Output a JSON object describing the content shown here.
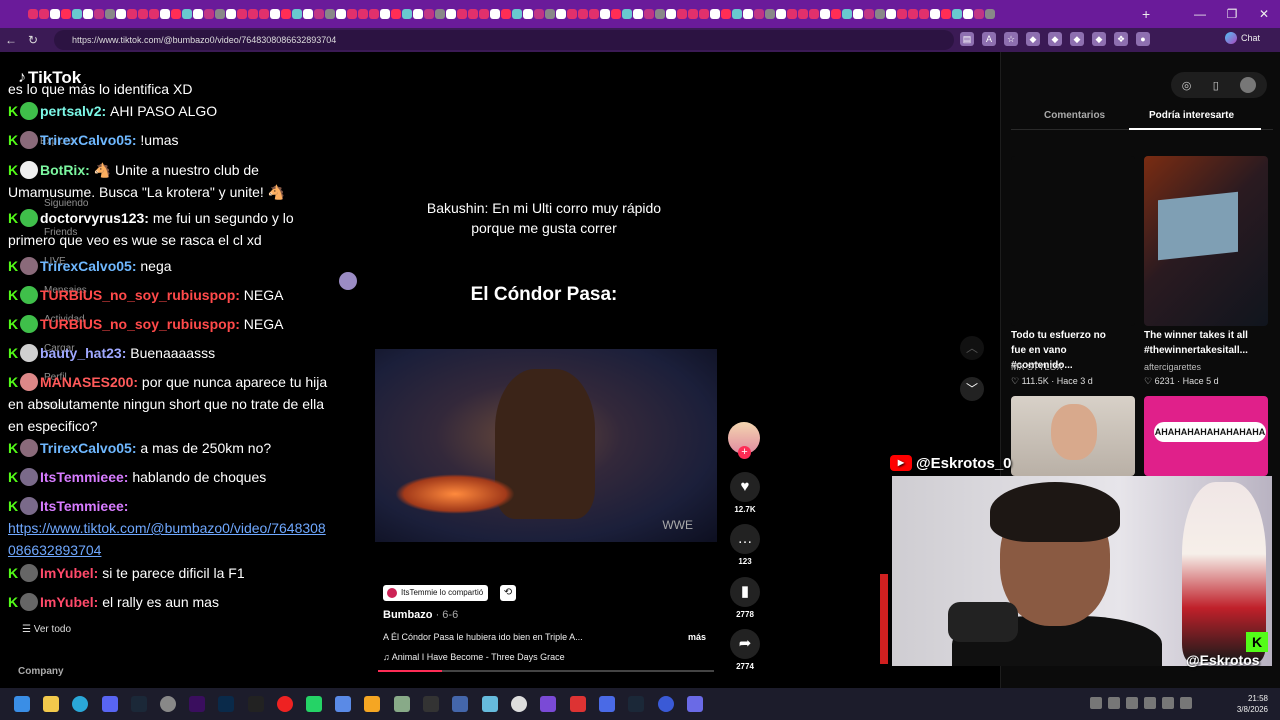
{
  "browser": {
    "url": "https://www.tiktok.com/@bumbazo0/video/7648308086632893704",
    "chat_label": "Chat",
    "new_tab": "+",
    "controls": [
      "—",
      "❐",
      "✕"
    ]
  },
  "tiktok": {
    "logo": "TikTok",
    "sidebar_ghost": [
      "Explorar",
      "Siguiendo",
      "Friends",
      "LIVE",
      "Mensajes",
      "Actividad",
      "Cargar",
      "Perfil",
      "Más"
    ],
    "ver_todo": "Ver todo",
    "company": "Company"
  },
  "chat": [
    {
      "user": "",
      "text": "es lo que más lo identifica XD",
      "color": "#ffffff"
    },
    {
      "user": "pertsalv2:",
      "text": "AHI PASO ALGO",
      "color": "#7cf7e6"
    },
    {
      "user": "TrirexCalvo05:",
      "text": "!umas",
      "color": "#6fb8ff"
    },
    {
      "user": "BotRix:",
      "text": "🐴 Unite a nuestro club de Umamusume. Busca \"La krotera\" y unite! 🐴",
      "color": "#7cf7a0"
    },
    {
      "user": "doctorvyrus123:",
      "text": "me fui un segundo y lo primero que veo es wue se rasca el cl xd",
      "color": "#ffffff"
    },
    {
      "user": "TrirexCalvo05:",
      "text": "nega",
      "color": "#6fb8ff"
    },
    {
      "user": "TURBIUS_no_soy_rubiuspop:",
      "text": "NEGA",
      "color": "#ff4a4a"
    },
    {
      "user": "TURBIUS_no_soy_rubiuspop:",
      "text": "NEGA",
      "color": "#ff4a4a"
    },
    {
      "user": "bauty_hat23:",
      "text": "Buenaaaasss",
      "color": "#9fa8ff"
    },
    {
      "user": "MANASES200:",
      "text": "por que nunca aparece tu hija en absolutamente ningun short que no trate de ella en especifico?",
      "color": "#ff5a5a"
    },
    {
      "user": "TrirexCalvo05:",
      "text": "a mas de 250km no?",
      "color": "#6fb8ff"
    },
    {
      "user": "ItsTemmieee:",
      "text": "hablando de choques",
      "color": "#d77cff"
    },
    {
      "user": "ItsTemmieee:",
      "text": "",
      "color": "#d77cff"
    },
    {
      "user": "",
      "text": "https://www.tiktok.com/@bumbazo0/video/7648308086632893704",
      "color": "#6fa8ff"
    },
    {
      "user": "ImYubel:",
      "text": "si te parece dificil la F1",
      "color": "#ff4a6a"
    },
    {
      "user": "ImYubel:",
      "text": "el rally es aun mas",
      "color": "#ff4a6a"
    }
  ],
  "video": {
    "caption": "Bakushin: En mi Ulti corro muy rápido porque me gusta correr",
    "overlay_title": "El Cóndor Pasa:",
    "shared_by": "ItsTemmie lo compartió",
    "author": "Bumbazo",
    "date": "· 6-6",
    "description": "A Él Cóndor Pasa le hubiera ido bien en Triple A...",
    "more": "más",
    "music": "Animal I Have Become - Three Days Grace",
    "watermark": "WWE",
    "progress": 0.19,
    "likes": "12.7K",
    "comments": "123",
    "saves": "2778",
    "shares": "2774"
  },
  "right_panel": {
    "tab_comments": "Comentarios",
    "tab_interest": "Podría interesarte",
    "videos": [
      {
        "title": "Todo tu esfuerzo no fue en vano #contenido...",
        "author": "MX STYLOX",
        "likes": "♡ 111.5K",
        "ago": "· Hace 3 d"
      },
      {
        "title": "The winner takes it all #thewinnertakesitall...",
        "author": "aftercigarettes",
        "likes": "♡ 6231",
        "ago": "· Hace 5 d"
      }
    ],
    "thumb_text": "AHAHAHAHAHAHAHAHA"
  },
  "stream": {
    "yt_handle": "@Eskrotos_0",
    "kick_handle": "@Eskrotos"
  },
  "taskbar": {
    "time": "21:58",
    "date": "3/8/2026"
  },
  "colors": {
    "tabbar": "#6a1b9a",
    "kick_green": "#53fc18",
    "tiktok_red": "#fe2c55"
  }
}
